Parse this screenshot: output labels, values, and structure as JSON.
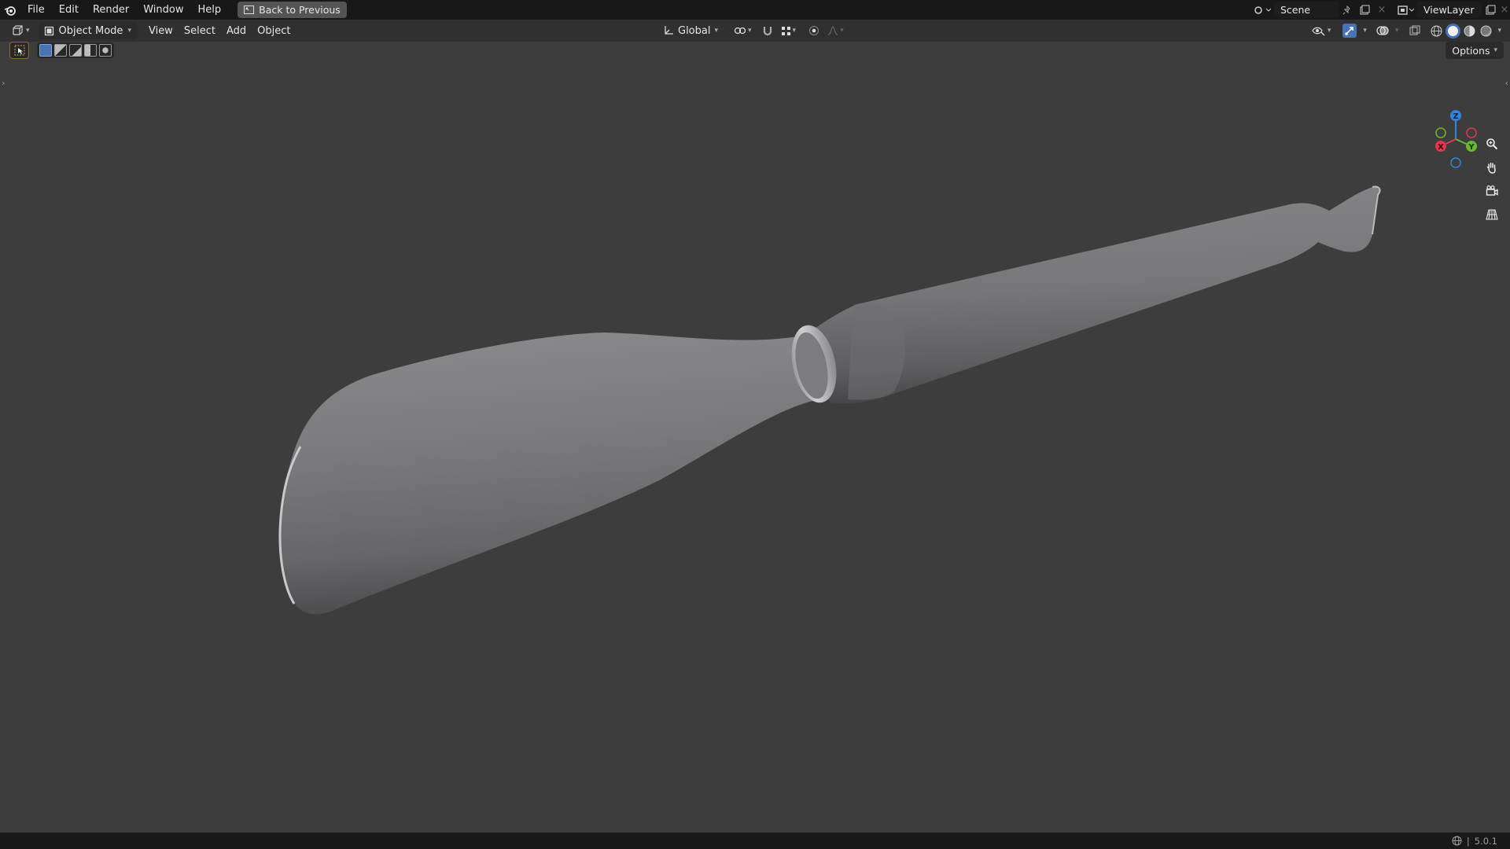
{
  "topbar": {
    "menu": [
      "File",
      "Edit",
      "Render",
      "Window",
      "Help"
    ],
    "back_button": "Back to Previous",
    "scene_name": "Scene",
    "view_layer": "ViewLayer"
  },
  "header": {
    "mode": "Object Mode",
    "menus": [
      "View",
      "Select",
      "Add",
      "Object"
    ],
    "transform_orientation": "Global"
  },
  "viewport": {
    "options_label": "Options",
    "gizmo_axes": [
      "Z",
      "Y",
      "X"
    ],
    "axis_colors": {
      "x": "#e0384d",
      "y": "#6ab82e",
      "z": "#2e86de"
    },
    "nav_icons": [
      "zoom-icon",
      "pan-hand-icon",
      "camera-icon",
      "perspective-grid-icon"
    ]
  },
  "statusbar": {
    "version": "5.0.1"
  }
}
